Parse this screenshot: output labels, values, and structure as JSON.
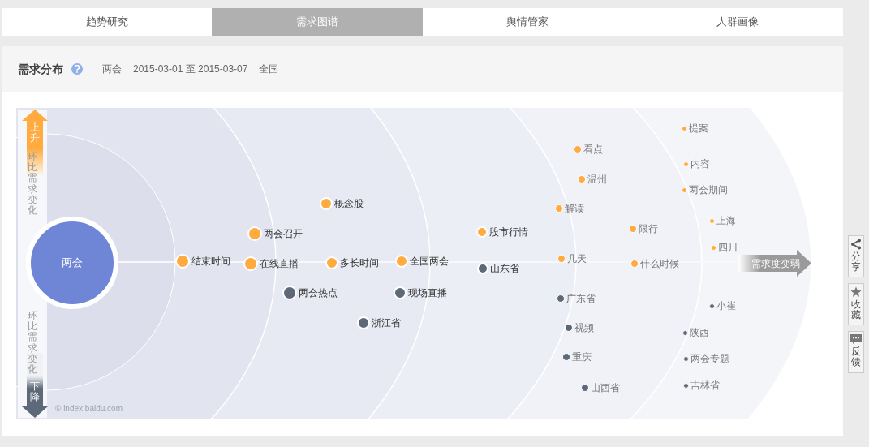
{
  "tabs": [
    {
      "label": "趋势研究",
      "selected": false
    },
    {
      "label": "需求图谱",
      "selected": true
    },
    {
      "label": "舆情管家",
      "selected": false
    },
    {
      "label": "人群画像",
      "selected": false
    }
  ],
  "header": {
    "title": "需求分布",
    "keyword": "两会",
    "date_range": "2015-03-01 至 2015-03-07",
    "region": "全国"
  },
  "chart": {
    "center": "两会",
    "up_label": "上升",
    "down_label": "下降",
    "axis_label_up": "环比需求变化",
    "axis_label_down": "环比需求变化",
    "arrow_label": "需求度变弱",
    "credit": "© index.baidu.com",
    "rings": [
      {
        "nodes": [
          {
            "label": "结束时间",
            "color": "#ffab40"
          },
          {
            "label": "两会召开",
            "color": "#ffab40"
          },
          {
            "label": "在线直播",
            "color": "#ffab40"
          },
          {
            "label": "两会热点",
            "color": "#5d6878"
          }
        ]
      },
      {
        "nodes": [
          {
            "label": "概念股",
            "color": "#ffab40"
          },
          {
            "label": "多长时间",
            "color": "#ffab40"
          },
          {
            "label": "全国两会",
            "color": "#ffab40"
          },
          {
            "label": "现场直播",
            "color": "#5d6878"
          },
          {
            "label": "浙江省",
            "color": "#5d6878"
          }
        ]
      },
      {
        "nodes": [
          {
            "label": "股市行情",
            "color": "#ffab40"
          },
          {
            "label": "山东省",
            "color": "#5d6878"
          }
        ]
      },
      {
        "nodes": [
          {
            "label": "看点",
            "color": "#ffab40"
          },
          {
            "label": "温州",
            "color": "#ffab40"
          },
          {
            "label": "解读",
            "color": "#ffab40"
          },
          {
            "label": "限行",
            "color": "#ffab40"
          },
          {
            "label": "几天",
            "color": "#ffab40"
          },
          {
            "label": "什么时候",
            "color": "#ffab40"
          },
          {
            "label": "广东省",
            "color": "#5d6878"
          },
          {
            "label": "视频",
            "color": "#5d6878"
          },
          {
            "label": "重庆",
            "color": "#5d6878"
          },
          {
            "label": "山西省",
            "color": "#5d6878"
          }
        ]
      },
      {
        "nodes": [
          {
            "label": "提案",
            "color": "#ffab40"
          },
          {
            "label": "内容",
            "color": "#ffab40"
          },
          {
            "label": "两会期间",
            "color": "#ffab40"
          },
          {
            "label": "上海",
            "color": "#ffab40"
          },
          {
            "label": "四川",
            "color": "#ffab40"
          },
          {
            "label": "小崔",
            "color": "#5d6878"
          },
          {
            "label": "陕西",
            "color": "#5d6878"
          },
          {
            "label": "两会专题",
            "color": "#5d6878"
          },
          {
            "label": "吉林省",
            "color": "#5d6878"
          }
        ]
      }
    ]
  },
  "side_buttons": [
    {
      "label": "分享",
      "kind": "share"
    },
    {
      "label": "收藏",
      "kind": "favorite"
    },
    {
      "label": "反馈",
      "kind": "feedback"
    }
  ]
}
